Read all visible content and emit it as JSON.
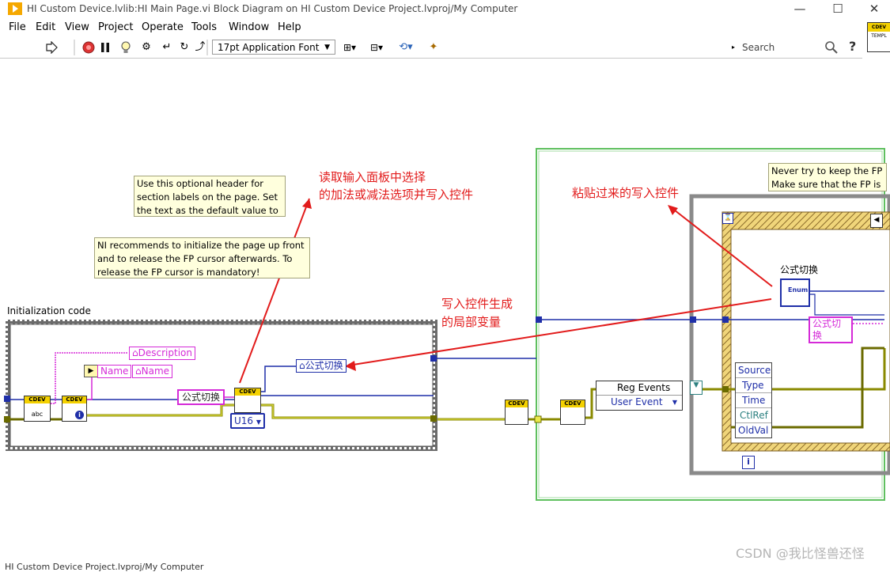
{
  "window": {
    "title": "HI Custom Device.lvlib:HI Main Page.vi Block Diagram on HI Custom Device Project.lvproj/My Computer",
    "controls": [
      "—",
      "☐",
      "✕"
    ]
  },
  "menu": [
    "File",
    "Edit",
    "View",
    "Project",
    "Operate",
    "Tools",
    "Window",
    "Help"
  ],
  "toolbar": {
    "font": "17pt Application Font",
    "search_placeholder": "Search",
    "vi_icon_top": "CDEV",
    "vi_icon_bottom": "TEMPL"
  },
  "diagram": {
    "notes": {
      "header": "Use this optional header for section labels on the page. Set the text as the default value to",
      "recommend": "NI recommends to initialize the page up front and to release the FP cursor afterwards. To release the FP cursor is mandatory!",
      "never": "Never try to keep the FP",
      "make_sure": "Make sure that the FP is"
    },
    "annotations": {
      "read_select": "读取输入面板中选择",
      "read_select_2": "的加法或减法选项并写入控件",
      "pasted_control": "粘贴过来的写入控件",
      "local_var": "写入控件生成",
      "local_var_2": "的局部变量"
    },
    "init_label": "Initialization code",
    "nodes": {
      "description": "Description",
      "name_in": "Name",
      "name_out": "Name",
      "formula_term": "公式切换",
      "formula_local": "公式切换",
      "u16": "U16",
      "cdev": "CDEV",
      "abc": "abc",
      "reg_events": "Reg Events",
      "user_event": "User Event",
      "formula_ctrl_label": "公式切换",
      "enum": "Enum",
      "formula_right": "公式切换",
      "info_i": "i",
      "event_fields": [
        "Source",
        "Type",
        "Time",
        "CtlRef",
        "OldVal"
      ]
    }
  },
  "watermark": "CSDN @我比怪兽还怪",
  "statusbar": "HI Custom Device Project.lvproj/My Computer"
}
